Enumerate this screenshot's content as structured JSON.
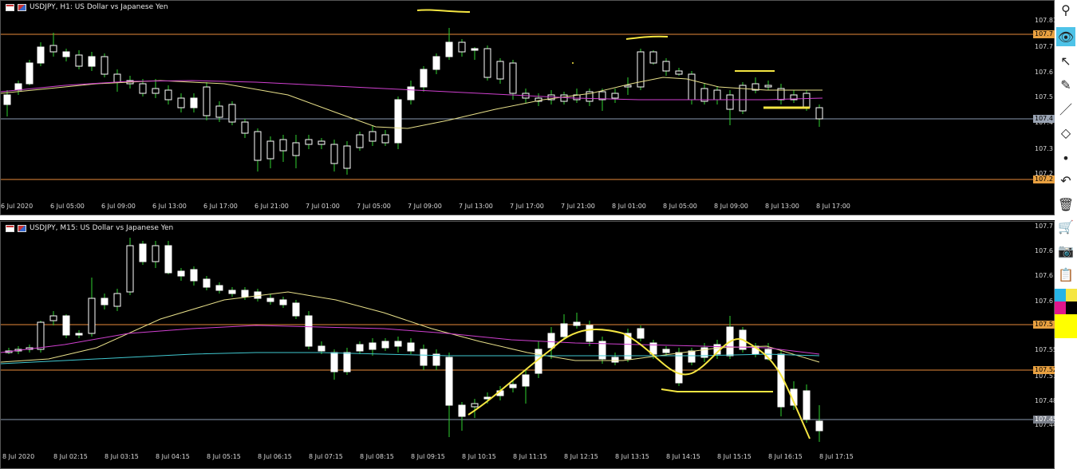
{
  "colors": {
    "background": "#000000",
    "bull": "#ffffff",
    "bear": "#000000",
    "wick": "#2fcf2f",
    "ma_fast": "#e8e08a",
    "ma_slow": "#d040d0",
    "ma_cyan": "#40c8d0",
    "hline_orange": "#e88a3a",
    "hline_gray": "#8a9ab0",
    "drawing_yellow": "#f5e642",
    "price_box_orange": "#e8a040"
  },
  "top_chart": {
    "title": "USDJPY, H1:  US Dollar vs Japanese Yen",
    "price_labels": [
      "107.815",
      "107.7",
      "107.6",
      "107.5",
      "107.4",
      "107.3",
      "107.2"
    ],
    "price_boxes": [
      {
        "text": "107.7",
        "kind": "orange"
      },
      {
        "text": "107.4",
        "kind": "gray"
      },
      {
        "text": "107.2",
        "kind": "orange"
      }
    ],
    "time_labels": [
      "6 Jul 2020",
      "6 Jul 05:00",
      "6 Jul 09:00",
      "6 Jul 13:00",
      "6 Jul 17:00",
      "6 Jul 21:00",
      "7 Jul 01:00",
      "7 Jul 05:00",
      "7 Jul 09:00",
      "7 Jul 13:00",
      "7 Jul 17:00",
      "7 Jul 21:00",
      "8 Jul 01:00",
      "8 Jul 05:00",
      "8 Jul 09:00",
      "8 Jul 13:00",
      "8 Jul 17:00"
    ]
  },
  "bottom_chart": {
    "title": "USDJPY, M15:  US Dollar vs Japanese Yen",
    "price_labels": [
      "107.7",
      "107.6",
      "107.6",
      "107.6",
      "107.550",
      "107.515",
      "107.480",
      "107.445"
    ],
    "price_boxes": [
      {
        "text": "107.5",
        "kind": "orange"
      },
      {
        "text": "107.522",
        "kind": "orange"
      },
      {
        "text": "107.451",
        "kind": "gray"
      }
    ],
    "time_labels": [
      "8 Jul 2020",
      "8 Jul 02:15",
      "8 Jul 03:15",
      "8 Jul 04:15",
      "8 Jul 05:15",
      "8 Jul 06:15",
      "8 Jul 07:15",
      "8 Jul 08:15",
      "8 Jul 09:15",
      "8 Jul 10:15",
      "8 Jul 11:15",
      "8 Jul 12:15",
      "8 Jul 13:15",
      "8 Jul 14:15",
      "8 Jul 15:15",
      "8 Jul 16:15",
      "8 Jul 17:15"
    ]
  },
  "toolbar": {
    "items": [
      {
        "name": "pin-icon",
        "glyph": "⚲"
      },
      {
        "name": "eye-icon",
        "glyph": "👁"
      },
      {
        "name": "cursor-icon",
        "glyph": "↖"
      },
      {
        "name": "eraser-icon",
        "glyph": "✎"
      },
      {
        "name": "line-icon",
        "glyph": "／"
      },
      {
        "name": "highlighter-icon",
        "glyph": "◇"
      },
      {
        "name": "dot-icon",
        "glyph": "•"
      },
      {
        "name": "undo-icon",
        "glyph": "↶"
      },
      {
        "name": "trash-icon",
        "glyph": "🗑"
      },
      {
        "name": "cart-icon",
        "glyph": "🛒"
      },
      {
        "name": "camera-icon",
        "glyph": "📷"
      },
      {
        "name": "clipboard-icon",
        "glyph": "📋"
      }
    ],
    "swatches": [
      "#27b3e6",
      "#e0168c",
      "#ffff00",
      "#000000"
    ]
  }
}
